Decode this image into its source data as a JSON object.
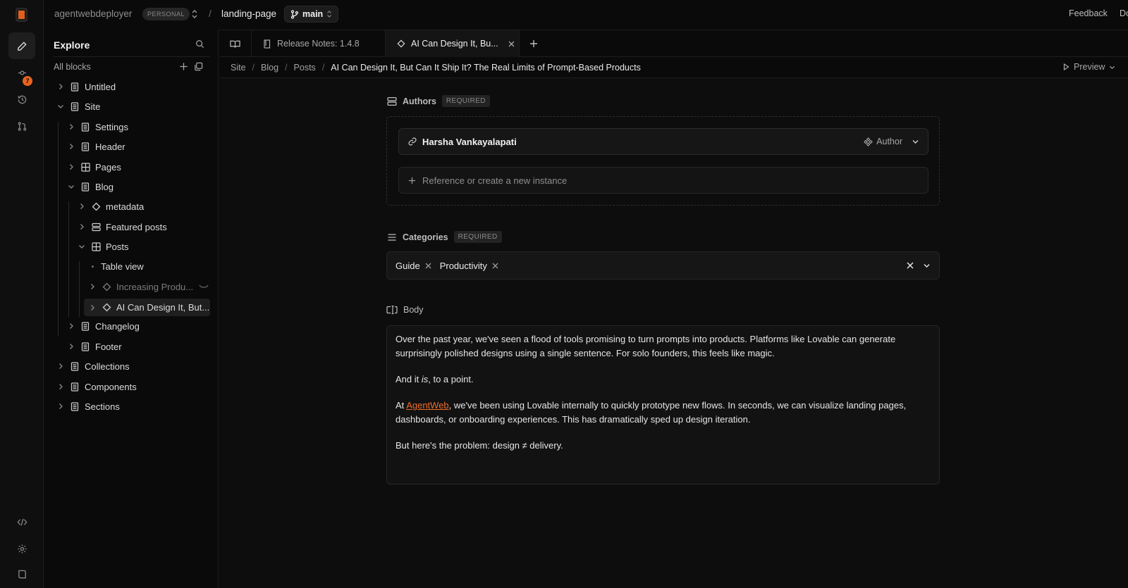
{
  "topbar": {
    "org": "agentwebdeployer",
    "plan": "PERSONAL",
    "project": "landing-page",
    "branch": "main",
    "feedback": "Feedback",
    "docs": "Do"
  },
  "rail": {
    "notification_count": "7"
  },
  "sidebar": {
    "title": "Explore",
    "all_blocks": "All blocks",
    "tree": {
      "untitled": "Untitled",
      "site": "Site",
      "settings": "Settings",
      "header": "Header",
      "pages": "Pages",
      "blog": "Blog",
      "metadata": "metadata",
      "featured_posts": "Featured posts",
      "posts": "Posts",
      "table_view": "Table view",
      "post_1": "Increasing Produ...",
      "post_2": "AI Can Design It, But...",
      "changelog": "Changelog",
      "footer": "Footer",
      "collections": "Collections",
      "components": "Components",
      "sections": "Sections"
    }
  },
  "tabs": [
    {
      "label": "Release Notes: 1.4.8"
    },
    {
      "label": "AI Can Design It, Bu..."
    }
  ],
  "breadcrumb": {
    "items": [
      "Site",
      "Blog",
      "Posts"
    ],
    "current": "AI Can Design It, But Can It Ship It? The Real Limits of Prompt-Based Products",
    "preview": "Preview"
  },
  "authors": {
    "label": "Authors",
    "required": "REQUIRED",
    "author_name": "Harsha Vankayalapati",
    "author_type": "Author",
    "reference_placeholder": "Reference or create a new instance"
  },
  "categories": {
    "label": "Categories",
    "required": "REQUIRED",
    "chips": [
      "Guide",
      "Productivity"
    ]
  },
  "body": {
    "label": "Body",
    "p1": "Over the past year, we've seen a flood of tools promising to turn prompts into products. Platforms like Lovable can generate surprisingly polished designs using a single sentence. For solo founders, this feels like magic.",
    "p2_a": "And it ",
    "p2_em": "is",
    "p2_b": ", to a point.",
    "p3_a": "At ",
    "p3_link": "AgentWeb",
    "p3_b": ", we've been using Lovable internally to quickly prototype new flows. In seconds, we can visualize landing pages, dashboards, or onboarding experiences. This has dramatically sped up design iteration.",
    "p4": "But here's the problem: design ≠ delivery."
  },
  "colors": {
    "accent": "#e8651e",
    "link": "#ee6d2a",
    "background": "#0a0a0a"
  }
}
